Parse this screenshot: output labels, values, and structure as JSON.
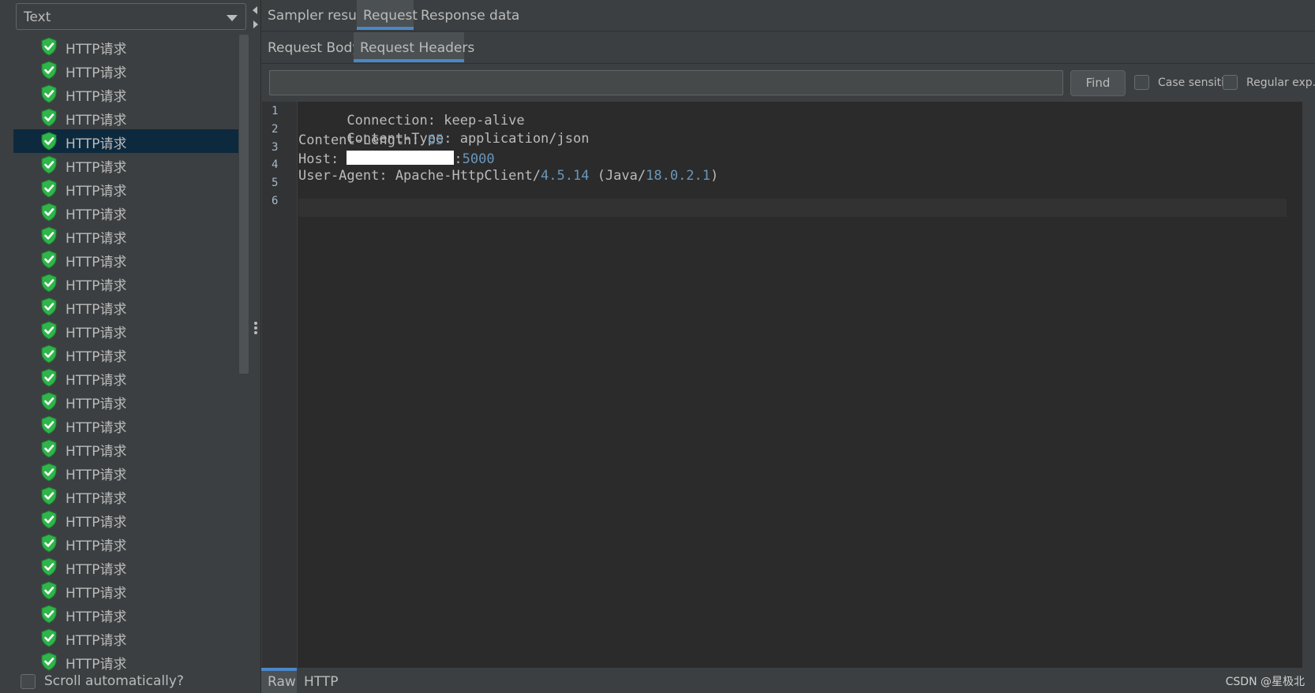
{
  "left_panel": {
    "renderer_select": {
      "value": "Text"
    },
    "results": [
      {
        "label": "HTTP请求",
        "status": "success"
      },
      {
        "label": "HTTP请求",
        "status": "success"
      },
      {
        "label": "HTTP请求",
        "status": "success"
      },
      {
        "label": "HTTP请求",
        "status": "success"
      },
      {
        "label": "HTTP请求",
        "status": "success",
        "selected": true
      },
      {
        "label": "HTTP请求",
        "status": "success"
      },
      {
        "label": "HTTP请求",
        "status": "success"
      },
      {
        "label": "HTTP请求",
        "status": "success"
      },
      {
        "label": "HTTP请求",
        "status": "success"
      },
      {
        "label": "HTTP请求",
        "status": "success"
      },
      {
        "label": "HTTP请求",
        "status": "success"
      },
      {
        "label": "HTTP请求",
        "status": "success"
      },
      {
        "label": "HTTP请求",
        "status": "success"
      },
      {
        "label": "HTTP请求",
        "status": "success"
      },
      {
        "label": "HTTP请求",
        "status": "success"
      },
      {
        "label": "HTTP请求",
        "status": "success"
      },
      {
        "label": "HTTP请求",
        "status": "success"
      },
      {
        "label": "HTTP请求",
        "status": "success"
      },
      {
        "label": "HTTP请求",
        "status": "success"
      },
      {
        "label": "HTTP请求",
        "status": "success"
      },
      {
        "label": "HTTP请求",
        "status": "success"
      },
      {
        "label": "HTTP请求",
        "status": "success"
      },
      {
        "label": "HTTP请求",
        "status": "success"
      },
      {
        "label": "HTTP请求",
        "status": "success"
      },
      {
        "label": "HTTP请求",
        "status": "success"
      },
      {
        "label": "HTTP请求",
        "status": "success"
      },
      {
        "label": "HTTP请求",
        "status": "success"
      }
    ],
    "scroll_automatically": {
      "label": "Scroll automatically?",
      "checked": false
    }
  },
  "tabs": {
    "main": [
      {
        "label": "Sampler result",
        "active": false
      },
      {
        "label": "Request",
        "active": true
      },
      {
        "label": "Response data",
        "active": false
      }
    ],
    "request": [
      {
        "label": "Request Body",
        "active": false
      },
      {
        "label": "Request Headers",
        "active": true
      }
    ]
  },
  "search": {
    "value": "",
    "find_label": "Find",
    "case_sensitive_label": "Case sensitive",
    "regular_exp_label": "Regular exp.",
    "case_sensitive_checked": false,
    "regular_exp_checked": false
  },
  "editor": {
    "lines": [
      {
        "number": "1",
        "text": "Connection: keep-alive"
      },
      {
        "number": "2",
        "text": "Content-Type: application/json"
      },
      {
        "number": "3",
        "key": "Content-Length: ",
        "value": "65"
      },
      {
        "number": "4",
        "key": "Host: ",
        "sep": ":",
        "port": "5000"
      },
      {
        "number": "5",
        "key": "User-Agent: Apache-HttpClient/",
        "version": "4.5.14",
        "mid": " (Java/",
        "java_version": "18.0.2.1",
        "end": ")"
      },
      {
        "number": "6",
        "text": ""
      }
    ]
  },
  "bottom_tabs": [
    {
      "label": "Raw",
      "active": true
    },
    {
      "label": "HTTP",
      "active": false
    }
  ],
  "watermark": "CSDN @星极北",
  "colors": {
    "background": "#3c3f41",
    "editor_background": "#2b2b2b",
    "accent": "#4a88c7",
    "selection": "#0d293e",
    "success_icon": "#2fb54a",
    "number_literal": "#6897bb"
  },
  "icons": {
    "result_status": "shield-check-icon",
    "dropdown": "chevron-down-icon"
  }
}
